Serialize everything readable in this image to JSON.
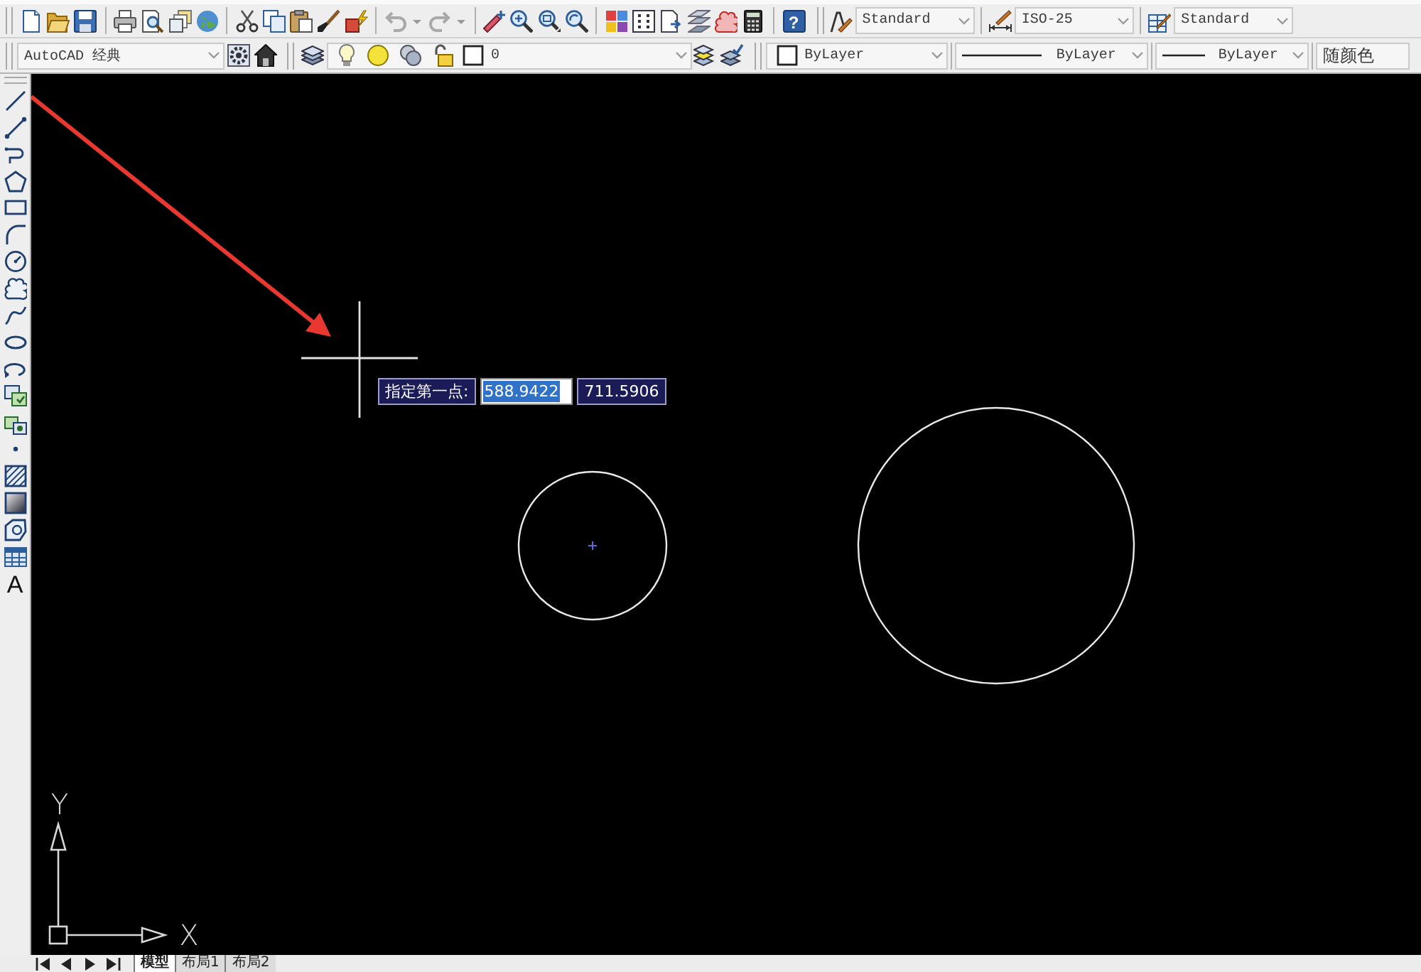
{
  "standard_toolbar": {
    "undo": {
      "disabled": true
    },
    "redo": {
      "disabled": true
    },
    "help_button": "?"
  },
  "styles_toolbar": {
    "text_style": "Standard",
    "dimension_style": "ISO-25",
    "table_style": "Standard"
  },
  "workspaces_toolbar": {
    "workspace": "AutoCAD 经典"
  },
  "layers_toolbar": {
    "current_layer": "0"
  },
  "properties_toolbar": {
    "color_setting": "ByLayer",
    "linetype": "ByLayer",
    "lineweight": "ByLayer",
    "plot_style": "随颜色"
  },
  "draw_toolbar": {
    "text_button": "A"
  },
  "drawing_area": {
    "prompt": {
      "label": "指定第一点:",
      "fields": [
        {
          "value": "588.9422",
          "selected": true
        },
        {
          "value": "711.5906",
          "selected": false
        }
      ]
    },
    "ucs_icon": {
      "y_label": "Y",
      "x_label": "X"
    }
  },
  "layout_tabs": [
    {
      "label": "模型",
      "selected": true
    },
    {
      "label": "布局1",
      "selected": false
    },
    {
      "label": "布局2",
      "selected": false
    }
  ]
}
